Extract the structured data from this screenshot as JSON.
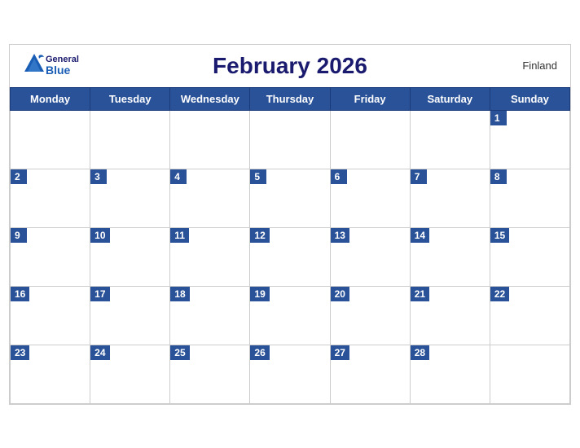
{
  "header": {
    "title": "February 2026",
    "country": "Finland",
    "logo_general": "General",
    "logo_blue": "Blue"
  },
  "weekdays": [
    "Monday",
    "Tuesday",
    "Wednesday",
    "Thursday",
    "Friday",
    "Saturday",
    "Sunday"
  ],
  "weeks": [
    [
      null,
      null,
      null,
      null,
      null,
      null,
      1
    ],
    [
      2,
      3,
      4,
      5,
      6,
      7,
      8
    ],
    [
      9,
      10,
      11,
      12,
      13,
      14,
      15
    ],
    [
      16,
      17,
      18,
      19,
      20,
      21,
      22
    ],
    [
      23,
      24,
      25,
      26,
      27,
      28,
      null
    ]
  ]
}
